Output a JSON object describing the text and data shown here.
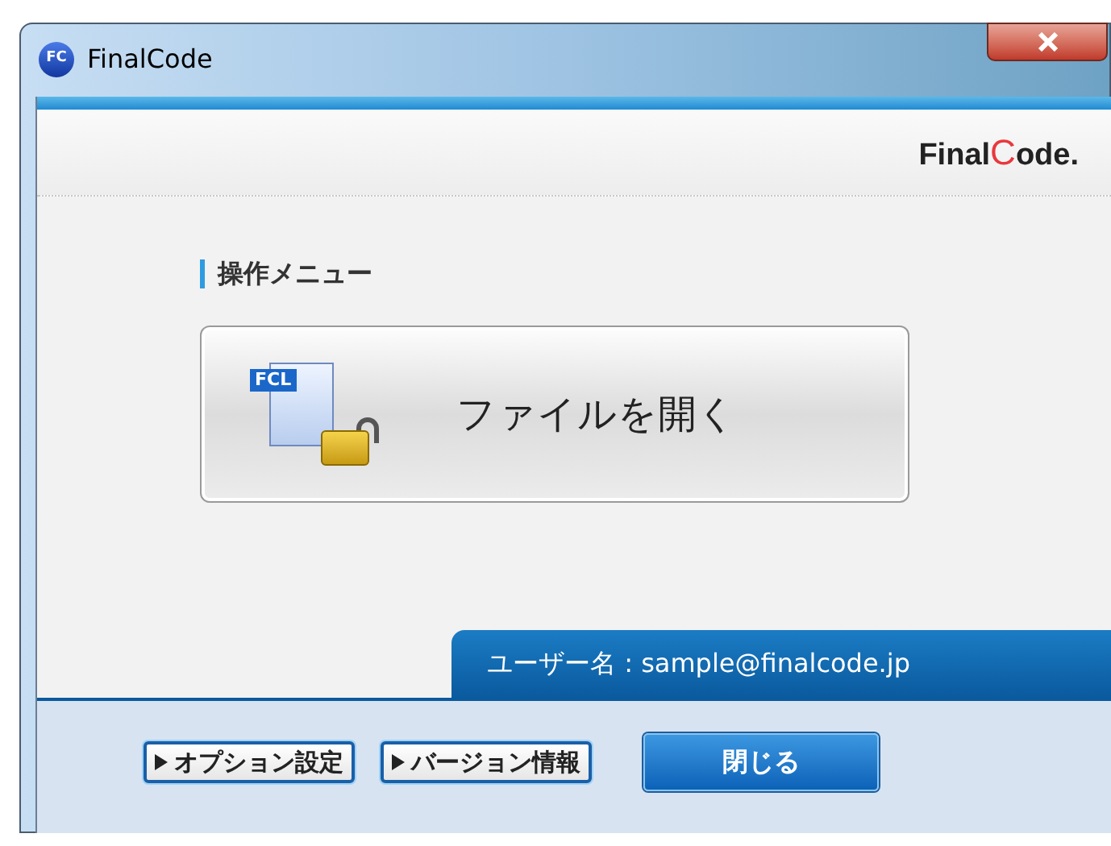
{
  "window": {
    "title": "FinalCode",
    "icon_text": "FC"
  },
  "logo": [
    {
      "text": "Final",
      "color": "#222222"
    },
    {
      "text": "C",
      "color": "#e8383d"
    },
    {
      "text": "ode.",
      "color": "#222222"
    }
  ],
  "menu": {
    "heading": "操作メニュー",
    "open_button": {
      "label": "ファイルを開く",
      "file_badge": "FCL"
    }
  },
  "user": {
    "label": "ユーザー名 : sample@finalcode.jp"
  },
  "buttons": [
    {
      "kind": "link",
      "label": "オプション設定"
    },
    {
      "kind": "link",
      "label": "バージョン情報"
    },
    {
      "kind": "primary",
      "label": "閉じる"
    }
  ]
}
